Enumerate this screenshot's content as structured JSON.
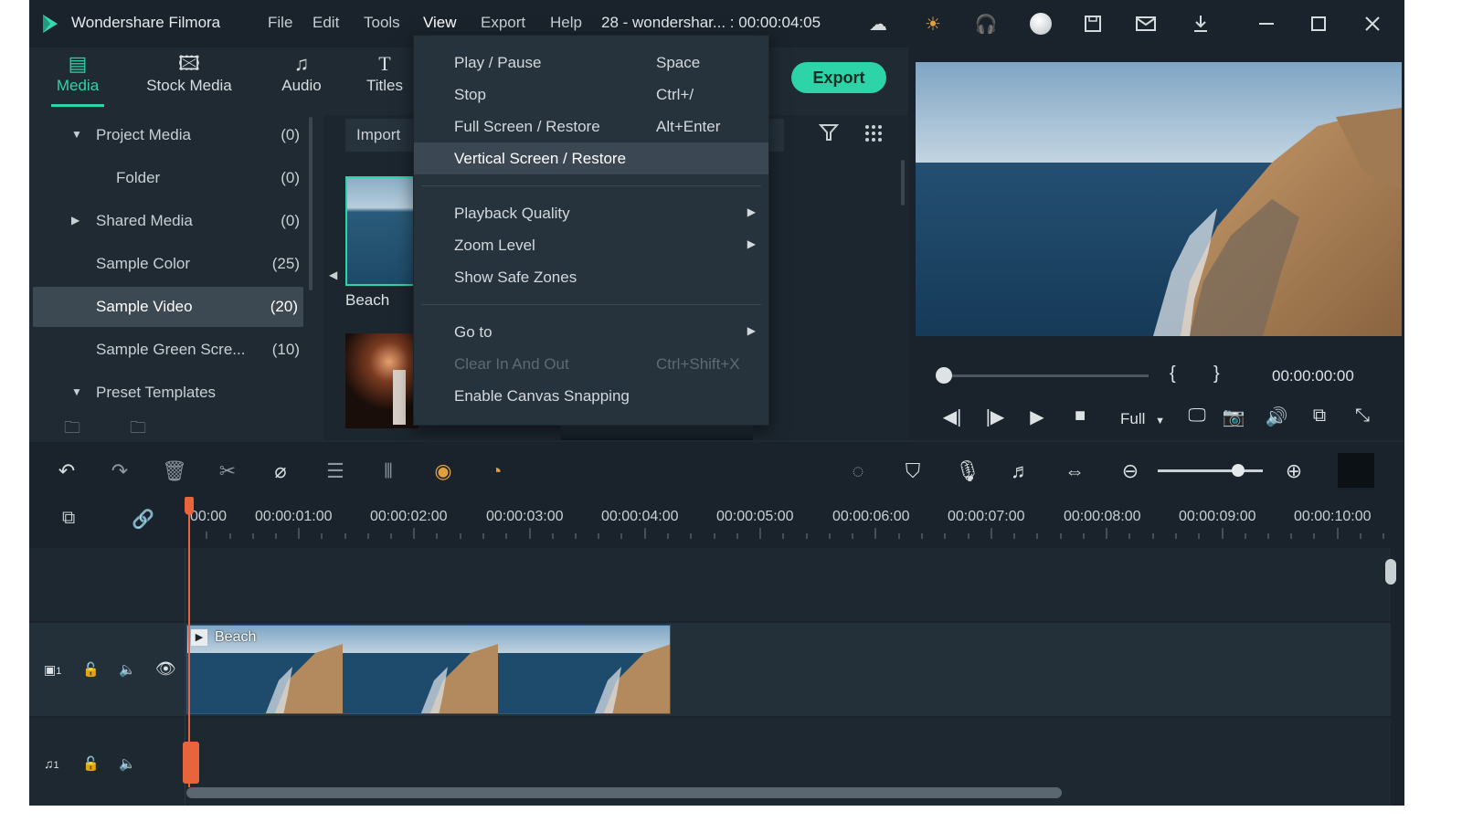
{
  "app": {
    "title": "Wondershare Filmora",
    "project_info": "28 - wondershar... : 00:00:04:05"
  },
  "menubar": [
    "File",
    "Edit",
    "Tools",
    "View",
    "Export",
    "Help"
  ],
  "media_tabs": [
    {
      "label": "Media",
      "icon": "media-icon"
    },
    {
      "label": "Stock Media",
      "icon": "stock-media-icon"
    },
    {
      "label": "Audio",
      "icon": "audio-icon"
    },
    {
      "label": "Titles",
      "icon": "titles-icon"
    }
  ],
  "export_label": "Export",
  "tree": [
    {
      "label": "Project Media",
      "count": "(0)"
    },
    {
      "label": "Folder",
      "count": "(0)"
    },
    {
      "label": "Shared Media",
      "count": "(0)"
    },
    {
      "label": "Sample Color",
      "count": "(25)"
    },
    {
      "label": "Sample Video",
      "count": "(20)"
    },
    {
      "label": "Sample Green Scre...",
      "count": "(10)"
    },
    {
      "label": "Preset Templates",
      "count": ""
    }
  ],
  "import_label": "Import",
  "thumb_label": "Beach",
  "view_menu": [
    {
      "label": "Play / Pause",
      "shortcut": "Space"
    },
    {
      "label": "Stop",
      "shortcut": "Ctrl+/"
    },
    {
      "label": "Full Screen / Restore",
      "shortcut": "Alt+Enter"
    },
    {
      "label": "Vertical Screen / Restore",
      "shortcut": ""
    },
    {
      "label": "Playback Quality",
      "shortcut": ""
    },
    {
      "label": "Zoom Level",
      "shortcut": ""
    },
    {
      "label": "Show Safe Zones",
      "shortcut": ""
    },
    {
      "label": "Go to",
      "shortcut": ""
    },
    {
      "label": "Clear In And Out",
      "shortcut": "Ctrl+Shift+X"
    },
    {
      "label": "Enable Canvas Snapping",
      "shortcut": ""
    }
  ],
  "player": {
    "timecode": "00:00:00:00",
    "quality": "Full",
    "progress": 0
  },
  "ruler": [
    "00:00",
    "00:00:01:00",
    "00:00:02:00",
    "00:00:03:00",
    "00:00:04:00",
    "00:00:05:00",
    "00:00:06:00",
    "00:00:07:00",
    "00:00:08:00",
    "00:00:09:00",
    "00:00:10:00"
  ],
  "clip": {
    "label": "Beach"
  },
  "tracks": {
    "video": "1",
    "audio": "1"
  },
  "colors": {
    "accent": "#2dd4a8",
    "playhead": "#e8643c",
    "selection": "#3c4852"
  }
}
